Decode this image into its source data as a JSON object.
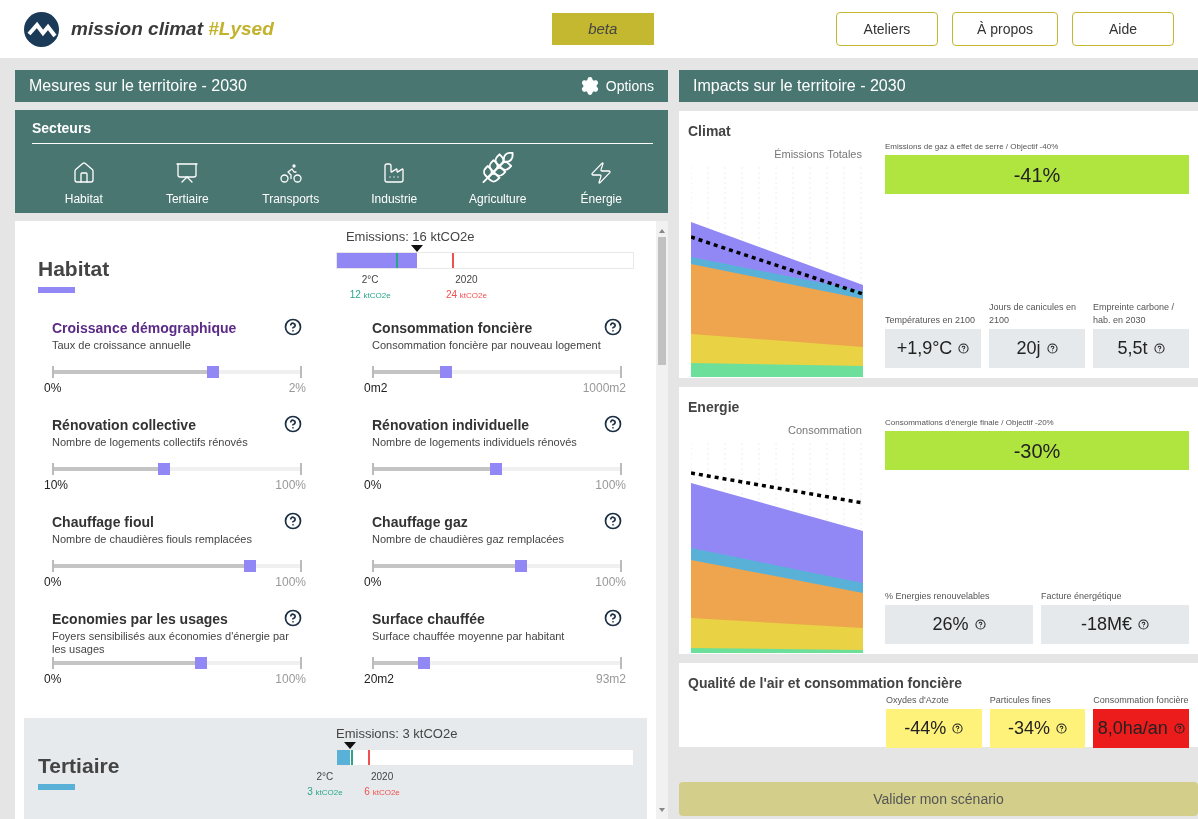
{
  "header": {
    "logo_text": "mission climat",
    "logo_tag": "#Lysed",
    "badge": "beta",
    "nav": [
      "Ateliers",
      "À propos",
      "Aide"
    ]
  },
  "measures": {
    "title": "Mesures sur le territoire - 2030",
    "options": "Options",
    "sectors_title": "Secteurs",
    "sectors": [
      {
        "label": "Habitat",
        "kind": "house",
        "selected": false
      },
      {
        "label": "Tertiaire",
        "kind": "board",
        "selected": false
      },
      {
        "label": "Transports",
        "kind": "bike",
        "selected": false
      },
      {
        "label": "Industrie",
        "kind": "factory",
        "selected": false
      },
      {
        "label": "Agriculture",
        "kind": "wheat",
        "selected": true
      },
      {
        "label": "Énergie",
        "kind": "energy",
        "selected": false
      }
    ],
    "sections": [
      {
        "title": "Habitat",
        "color": "#9188f5",
        "selected": true,
        "emissions": "Emissions: 16 ktCO2e",
        "level": 0.27,
        "markers": [
          {
            "label": "2°C",
            "value": "12",
            "unit": "ktCO2e",
            "color": "#2aa58a",
            "level": 0.2
          },
          {
            "label": "2020",
            "value": "24",
            "unit": "ktCO2e",
            "color": "#f0504f",
            "level": 0.39
          }
        ],
        "sliders": [
          {
            "title": "Croissance démographique",
            "subtitle": "Taux de croissance annuelle",
            "min": "0%",
            "max": "2%",
            "level": 0.65,
            "highlighted": true
          },
          {
            "title": "Consommation foncière",
            "subtitle": "Consommation foncière par nouveau logement",
            "min": "0m2",
            "max": "1000m2",
            "level": 0.3,
            "highlighted": false
          },
          {
            "title": "Rénovation collective",
            "subtitle": "Nombre de logements collectifs rénovés",
            "min": "10%",
            "max": "100%",
            "level": 0.45,
            "highlighted": false
          },
          {
            "title": "Rénovation individuelle",
            "subtitle": "Nombre de logements individuels rénovés",
            "min": "0%",
            "max": "100%",
            "level": 0.5,
            "highlighted": false
          },
          {
            "title": "Chauffage fioul",
            "subtitle": "Nombre de chaudières fiouls remplacées",
            "min": "0%",
            "max": "100%",
            "level": 0.8,
            "highlighted": false
          },
          {
            "title": "Chauffage gaz",
            "subtitle": "Nombre de chaudières gaz remplacées",
            "min": "0%",
            "max": "100%",
            "level": 0.6,
            "highlighted": false
          },
          {
            "title": "Economies par les usages",
            "subtitle": "Foyers sensibilisés aux économies d'énergie par les usages",
            "min": "0%",
            "max": "100%",
            "level": 0.6,
            "highlighted": false
          },
          {
            "title": "Surface chauffée",
            "subtitle": "Surface chauffée moyenne par habitant",
            "min": "20m2",
            "max": "93m2",
            "level": 0.21,
            "highlighted": false
          }
        ]
      },
      {
        "title": "Tertiaire",
        "color": "#5ab1d8",
        "selected": false,
        "emissions": "Emissions: 3 ktCO2e",
        "level": 0.045,
        "markers": [
          {
            "label": "2°C",
            "value": "3",
            "unit": "ktCO2e",
            "color": "#2aa58a",
            "level": 0.047
          },
          {
            "label": "2020",
            "value": "6",
            "unit": "ktCO2e",
            "color": "#f0504f",
            "level": 0.105
          }
        ]
      }
    ]
  },
  "impacts": {
    "title": "Impacts sur le territoire - 2030",
    "cards": [
      {
        "kind": "chart",
        "title": "Climat",
        "chart_title": "Émissions Totales",
        "main": {
          "label": "Emissions de gaz à effet de serre / Objectif -40%",
          "value": "-41%",
          "color": "#b0e53f"
        },
        "tiles": [
          {
            "label": "Températures en 2100",
            "value": "+1,9°C",
            "color": "#e6e9ec"
          },
          {
            "label": "Jours de canicules en 2100",
            "value": "20j",
            "color": "#e6e9ec"
          },
          {
            "label": "Empreinte carbone / hab. en 2030",
            "value": "5,5t",
            "color": "#e6e9ec"
          }
        ]
      },
      {
        "kind": "chart",
        "title": "Energie",
        "chart_title": "Consommation",
        "main": {
          "label": "Consommations d'énergie finale / Objectif -20%",
          "value": "-30%",
          "color": "#b0e53f"
        },
        "tiles": [
          {
            "label": "% Energies renouvelables",
            "value": "26%",
            "color": "#e6e9ec"
          },
          {
            "label": "Facture énergétique",
            "value": "-18M€",
            "color": "#e6e9ec"
          }
        ]
      },
      {
        "kind": "tiles",
        "title": "Qualité de l'air et consommation foncière",
        "tiles": [
          {
            "label": "Oxydes d'Azote",
            "value": "-44%",
            "color": "#fff27a"
          },
          {
            "label": "Particules fines",
            "value": "-34%",
            "color": "#fff27a"
          },
          {
            "label": "Consommation foncière",
            "value": "8,0ha/an",
            "color": "#ec1c1c"
          }
        ]
      }
    ]
  },
  "submit": "Valider mon scénario"
}
